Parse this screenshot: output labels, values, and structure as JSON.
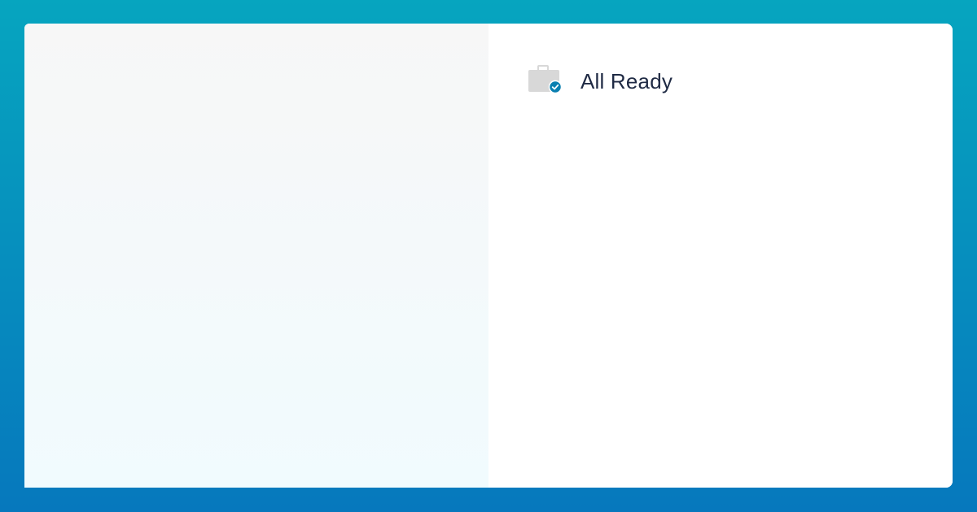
{
  "status": {
    "label": "All Ready",
    "icon": "briefcase-check-icon"
  },
  "colors": {
    "accent": "#0a7fb0",
    "text": "#1f2a44",
    "icon_gray": "#d8d8d8"
  }
}
